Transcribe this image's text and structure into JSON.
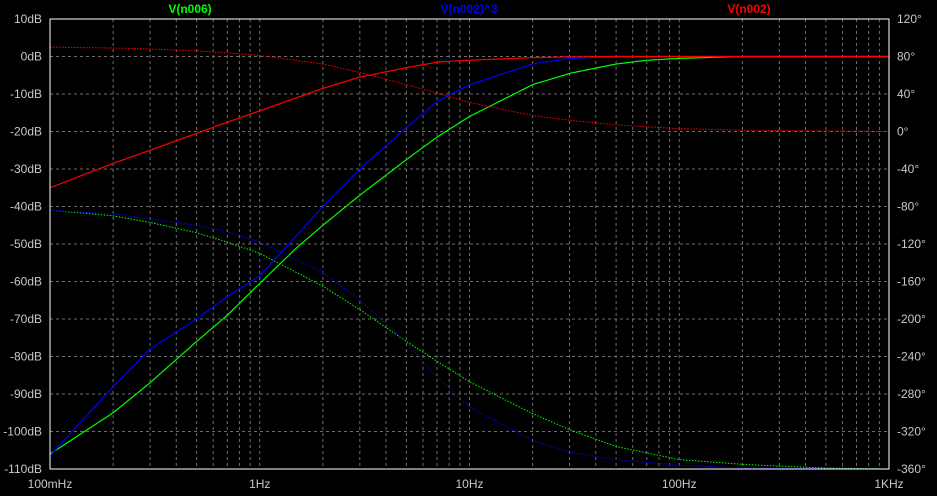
{
  "chart_data": {
    "type": "line",
    "x_scale": "log",
    "x_unit": "Hz",
    "xlim": [
      0.1,
      1000
    ],
    "ylim_left": [
      -110,
      10
    ],
    "ylim_right": [
      -360,
      120
    ],
    "grid": true,
    "legend_position": "top",
    "colors": {
      "background": "#000000",
      "frame": "#ffffff",
      "grid": "#6e6e6e",
      "tick_text": "#c8c8c8"
    },
    "x_ticks": [
      {
        "value": 0.1,
        "label": "100mHz"
      },
      {
        "value": 1,
        "label": "1Hz"
      },
      {
        "value": 10,
        "label": "10Hz"
      },
      {
        "value": 100,
        "label": "100Hz"
      },
      {
        "value": 1000,
        "label": "1KHz"
      }
    ],
    "y_left_ticks": [
      {
        "value": 10,
        "label": "10dB"
      },
      {
        "value": 0,
        "label": "0dB"
      },
      {
        "value": -10,
        "label": "-10dB"
      },
      {
        "value": -20,
        "label": "-20dB"
      },
      {
        "value": -30,
        "label": "-30dB"
      },
      {
        "value": -40,
        "label": "-40dB"
      },
      {
        "value": -50,
        "label": "-50dB"
      },
      {
        "value": -60,
        "label": "-60dB"
      },
      {
        "value": -70,
        "label": "-70dB"
      },
      {
        "value": -80,
        "label": "-80dB"
      },
      {
        "value": -90,
        "label": "-90dB"
      },
      {
        "value": -100,
        "label": "-100dB"
      },
      {
        "value": -110,
        "label": "-110dB"
      }
    ],
    "y_right_ticks": [
      {
        "value": 120,
        "label": "120°"
      },
      {
        "value": 80,
        "label": "80°"
      },
      {
        "value": 40,
        "label": "40°"
      },
      {
        "value": 0,
        "label": "0°"
      },
      {
        "value": -40,
        "label": "-40°"
      },
      {
        "value": -80,
        "label": "-80°"
      },
      {
        "value": -120,
        "label": "-120°"
      },
      {
        "value": -160,
        "label": "-160°"
      },
      {
        "value": -200,
        "label": "-200°"
      },
      {
        "value": -240,
        "label": "-240°"
      },
      {
        "value": -280,
        "label": "-280°"
      },
      {
        "value": -320,
        "label": "-320°"
      },
      {
        "value": -360,
        "label": "-360°"
      }
    ],
    "series": [
      {
        "name": "V(n006)",
        "color": "#00ff00",
        "magnitude_db": {
          "x": [
            0.1,
            0.2,
            0.3,
            0.5,
            0.7,
            1,
            1.5,
            2,
            3,
            5,
            7,
            10,
            20,
            30,
            50,
            70,
            100,
            200,
            300,
            500,
            1000
          ],
          "y": [
            -106,
            -95,
            -87,
            -76,
            -69,
            -60.5,
            -51,
            -45,
            -37,
            -27.5,
            -21.5,
            -16,
            -7.5,
            -4.5,
            -2,
            -1,
            -0.5,
            0,
            0,
            0,
            0
          ]
        },
        "phase_deg": {
          "x": [
            0.1,
            0.2,
            0.3,
            0.5,
            0.7,
            1,
            2,
            3,
            5,
            7,
            10,
            20,
            30,
            50,
            100,
            200,
            300,
            500,
            1000
          ],
          "y": [
            -84,
            -90,
            -97,
            -108,
            -118,
            -130,
            -165,
            -190,
            -224,
            -245,
            -267,
            -301,
            -318,
            -336,
            -350,
            -355,
            -357,
            -359,
            -360
          ]
        }
      },
      {
        "name": "V(n002)^3",
        "color": "#0000ff",
        "magnitude_db": {
          "x": [
            0.1,
            0.2,
            0.3,
            0.5,
            0.7,
            1,
            2,
            3,
            5,
            7,
            10,
            20,
            30,
            50,
            100,
            1000
          ],
          "y": [
            -106.5,
            -88,
            -78,
            -70,
            -64,
            -58.5,
            -40,
            -30,
            -19,
            -12,
            -7.5,
            -2,
            -0.5,
            0,
            0,
            0
          ]
        },
        "phase_deg": {
          "x": [
            0.1,
            0.2,
            0.3,
            0.5,
            0.7,
            1,
            2,
            3,
            5,
            7,
            10,
            20,
            30,
            50,
            100,
            200,
            1000
          ],
          "y": [
            -84,
            -88,
            -93,
            -100,
            -107,
            -118,
            -150,
            -180,
            -225,
            -262,
            -294,
            -330,
            -342,
            -350,
            -356,
            -359,
            -360
          ]
        }
      },
      {
        "name": "V(n002)",
        "color": "#ff0000",
        "magnitude_db": {
          "x": [
            0.1,
            0.2,
            0.3,
            0.5,
            0.7,
            1,
            2,
            3,
            5,
            7,
            10,
            20,
            30,
            50,
            100,
            1000
          ],
          "y": [
            -35,
            -28.5,
            -25,
            -20.5,
            -17.5,
            -14.5,
            -8.5,
            -5.5,
            -3,
            -1.5,
            -1,
            -0.3,
            -0.1,
            0,
            0,
            0
          ]
        },
        "phase_deg": {
          "x": [
            0.1,
            0.2,
            0.3,
            0.5,
            0.7,
            1,
            2,
            3,
            5,
            7,
            10,
            20,
            30,
            50,
            100,
            200,
            300,
            1000
          ],
          "y": [
            90,
            89,
            88,
            86,
            84,
            81,
            72,
            63,
            50,
            41,
            31,
            17,
            12,
            7,
            3,
            1.5,
            1,
            0
          ]
        }
      }
    ]
  }
}
